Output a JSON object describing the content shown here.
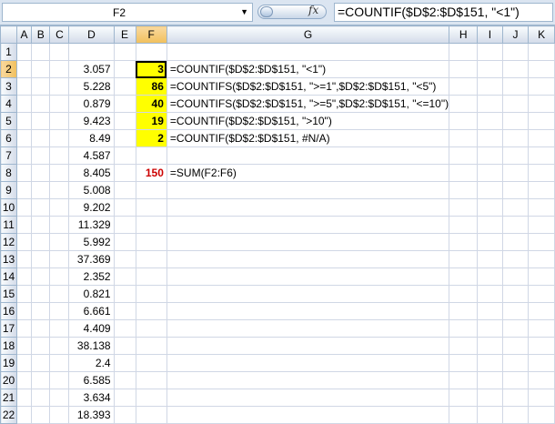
{
  "name_box": {
    "value": "F2"
  },
  "formula_bar": {
    "fx_label": "fx",
    "formula": "=COUNTIF($D$2:$D$151, \"<1\")"
  },
  "columns": [
    "A",
    "B",
    "C",
    "D",
    "E",
    "F",
    "G",
    "H",
    "I",
    "J",
    "K"
  ],
  "active_cell": {
    "column": "F",
    "row": 2
  },
  "rows": [
    {
      "n": "1",
      "d": "",
      "f": "",
      "g": ""
    },
    {
      "n": "2",
      "d": "3.057",
      "f": "3",
      "g": "=COUNTIF($D$2:$D$151, \"<1\")"
    },
    {
      "n": "3",
      "d": "5.228",
      "f": "86",
      "g": "=COUNTIFS($D$2:$D$151, \">=1\",$D$2:$D$151, \"<5\")"
    },
    {
      "n": "4",
      "d": "0.879",
      "f": "40",
      "g": "=COUNTIFS($D$2:$D$151, \">=5\",$D$2:$D$151, \"<=10\")"
    },
    {
      "n": "5",
      "d": "9.423",
      "f": "19",
      "g": "=COUNTIF($D$2:$D$151, \">10\")"
    },
    {
      "n": "6",
      "d": "8.49",
      "f": "2",
      "g": "=COUNTIF($D$2:$D$151, #N/A)"
    },
    {
      "n": "7",
      "d": "4.587",
      "f": "",
      "g": ""
    },
    {
      "n": "8",
      "d": "8.405",
      "f": "150",
      "g": "=SUM(F2:F6)"
    },
    {
      "n": "9",
      "d": "5.008",
      "f": "",
      "g": ""
    },
    {
      "n": "10",
      "d": "9.202",
      "f": "",
      "g": ""
    },
    {
      "n": "11",
      "d": "11.329",
      "f": "",
      "g": ""
    },
    {
      "n": "12",
      "d": "5.992",
      "f": "",
      "g": ""
    },
    {
      "n": "13",
      "d": "37.369",
      "f": "",
      "g": ""
    },
    {
      "n": "14",
      "d": "2.352",
      "f": "",
      "g": ""
    },
    {
      "n": "15",
      "d": "0.821",
      "f": "",
      "g": ""
    },
    {
      "n": "16",
      "d": "6.661",
      "f": "",
      "g": ""
    },
    {
      "n": "17",
      "d": "4.409",
      "f": "",
      "g": ""
    },
    {
      "n": "18",
      "d": "38.138",
      "f": "",
      "g": ""
    },
    {
      "n": "19",
      "d": "2.4",
      "f": "",
      "g": ""
    },
    {
      "n": "20",
      "d": "6.585",
      "f": "",
      "g": ""
    },
    {
      "n": "21",
      "d": "3.634",
      "f": "",
      "g": ""
    },
    {
      "n": "22",
      "d": "18.393",
      "f": "",
      "g": ""
    }
  ],
  "colors": {
    "highlight_fill": "#ffff00",
    "total_text": "#cc0000",
    "active_header": "#f1c05c"
  },
  "icons": {
    "name_box_dropdown": "chevron-down-icon",
    "function": "fx-icon"
  }
}
